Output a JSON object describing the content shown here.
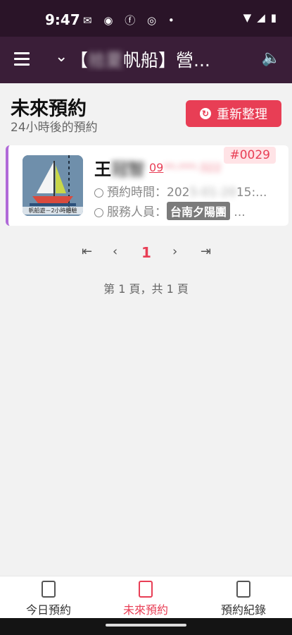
{
  "status_bar": {
    "time": "9:47",
    "left_icons": "✉ ◉ ⓕ ◎ •",
    "right_icons": "▾◢▮"
  },
  "app_bar": {
    "title_prefix": "【",
    "title_blur": "拾夏",
    "title_rest": "帆船】營...",
    "menu_icon": "menu-icon",
    "speaker_icon": "speaker-icon"
  },
  "page": {
    "heading": "未來預約",
    "subheading": "24小時後的預約",
    "refresh_label": "重新整理"
  },
  "booking": {
    "order_no": "#0029",
    "customer_name": "王",
    "customer_name_blur": "冠智",
    "phone": "09",
    "phone_blur": "**-***-322",
    "time_label": "預約時間：",
    "time_value": "202",
    "time_value_blur": "5-01-20",
    "time_value_rest": "15:...",
    "staff_label": "服務人員：",
    "staff_value": "台南夕陽團",
    "staff_rest": "...",
    "thumb_caption": "帆船遊－2小時體驗"
  },
  "pagination": {
    "first": "⇤",
    "prev": "‹",
    "current": "1",
    "next": "›",
    "last": "⇥",
    "info": "第 1 頁，共 1 頁"
  },
  "bottom_nav": [
    {
      "label": "今日預約"
    },
    {
      "label": "未來預約"
    },
    {
      "label": "預約紀錄"
    }
  ],
  "colors": {
    "accent": "#e83e55",
    "appbar": "#3a1e38",
    "card_border": "#b06ad8"
  }
}
